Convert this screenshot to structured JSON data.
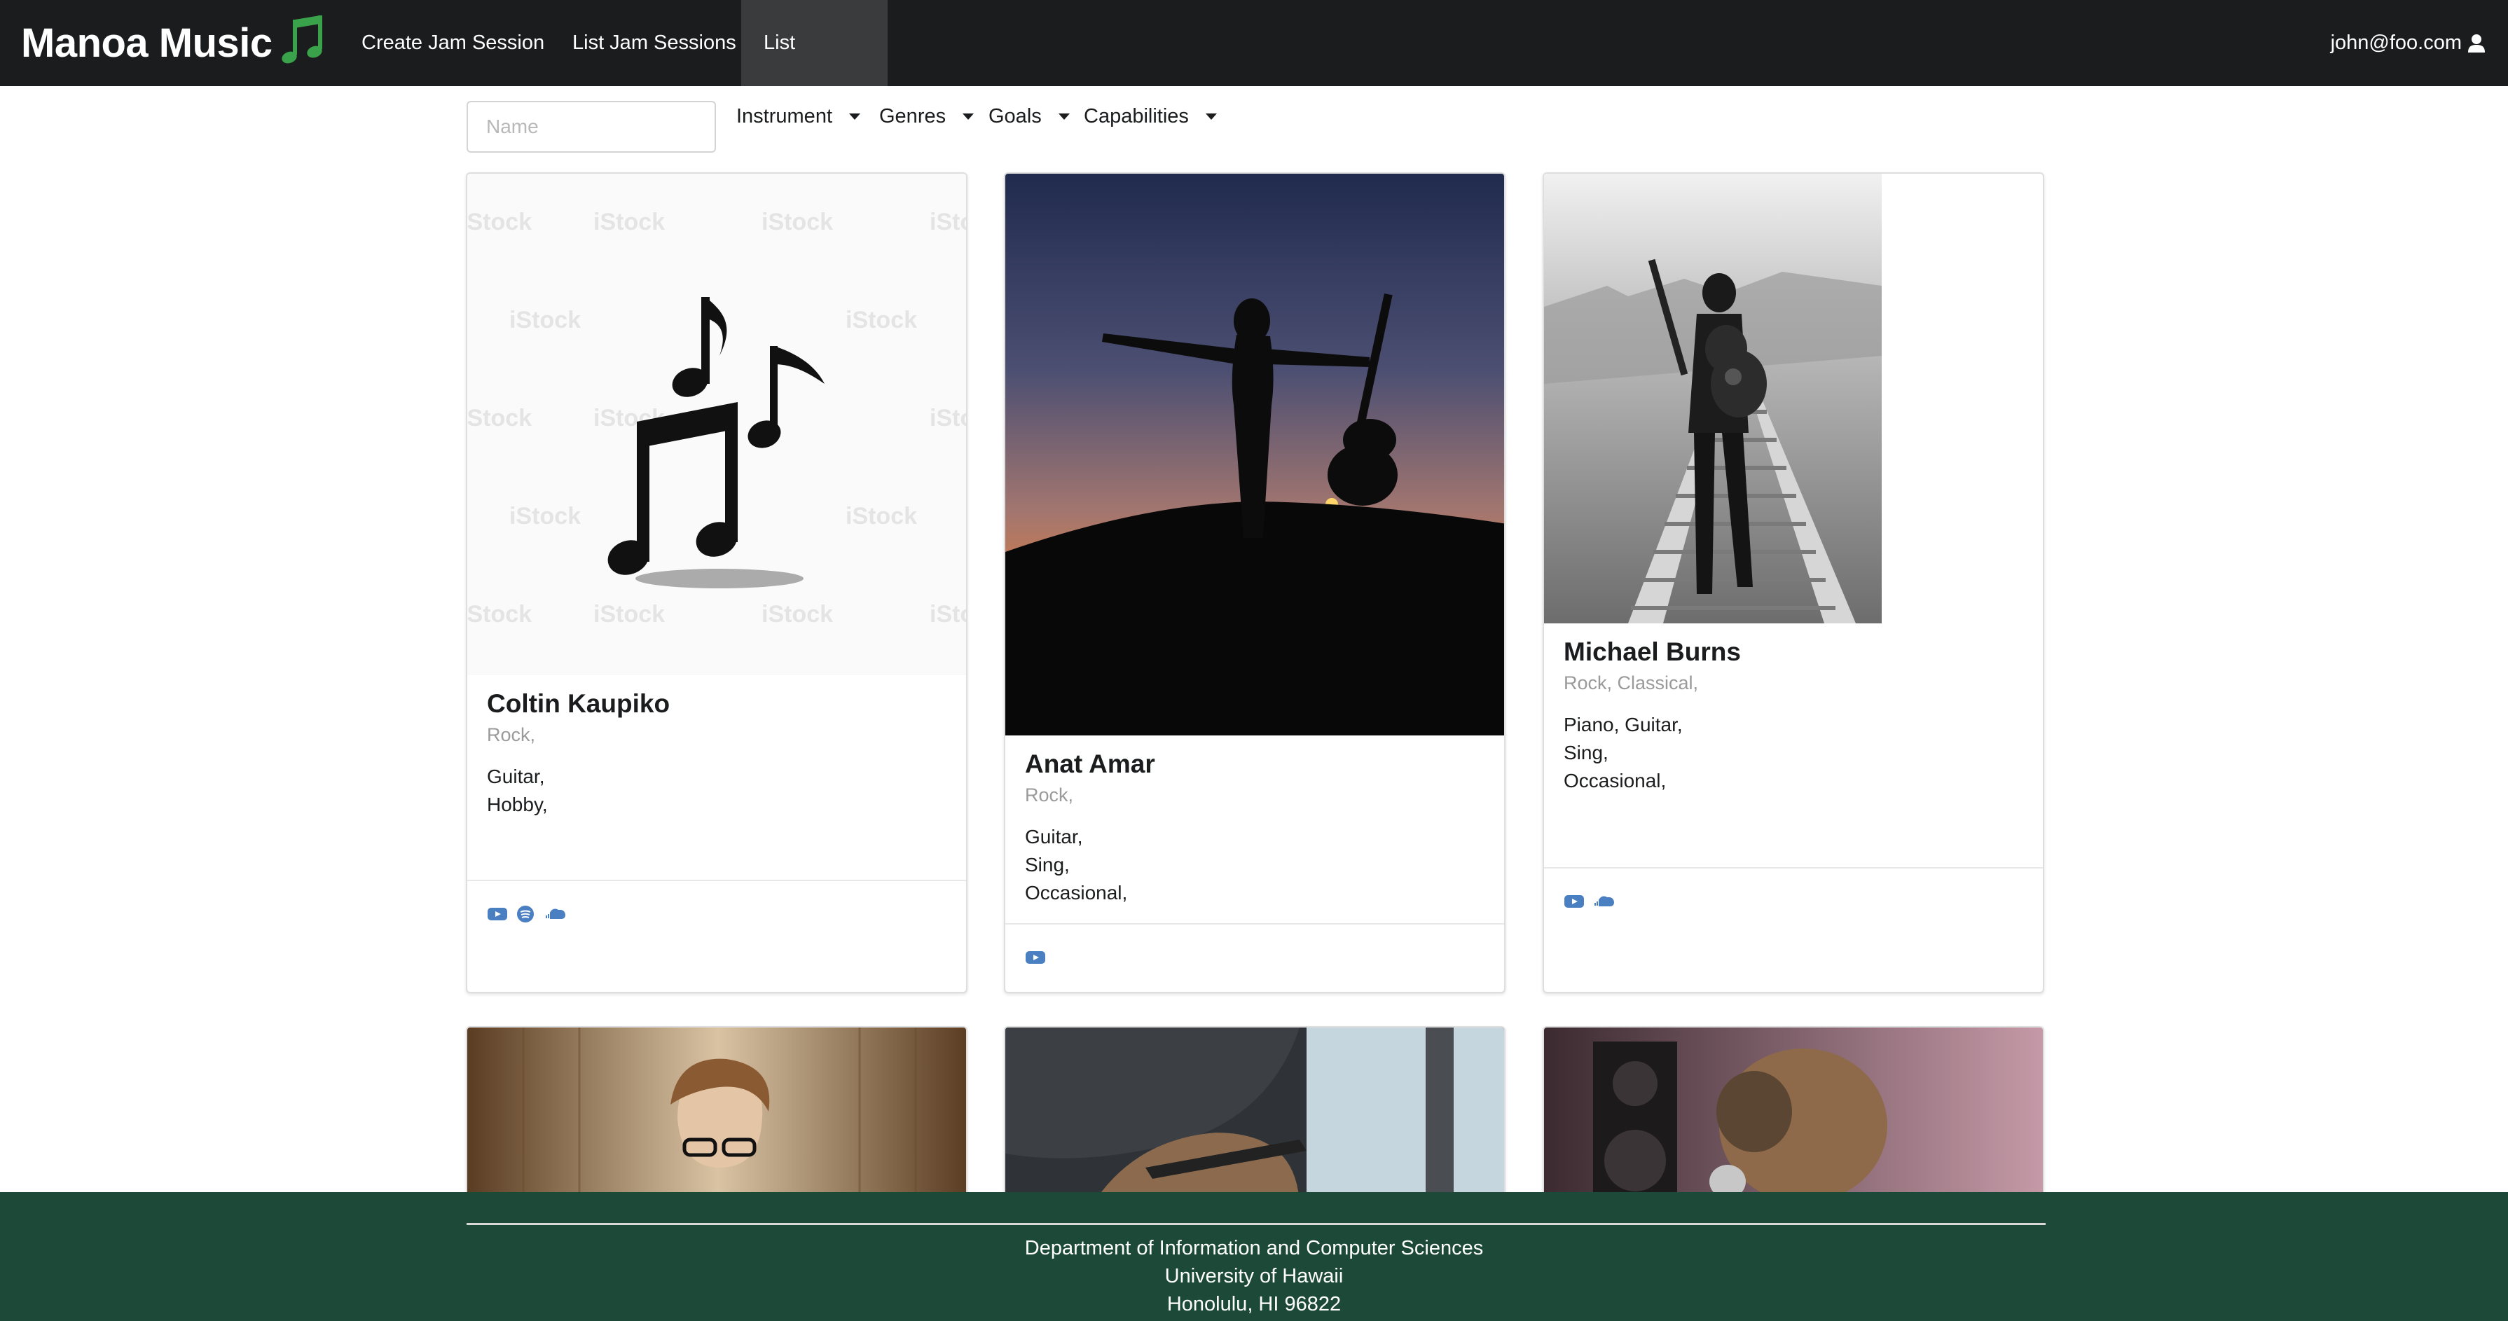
{
  "nav": {
    "brand": "Manoa Music",
    "items": [
      {
        "label": "Create Jam Session"
      },
      {
        "label": "List Jam Sessions"
      },
      {
        "label": "List Profiles",
        "active": true
      }
    ],
    "user": "john@foo.com",
    "user_icon": "user-icon",
    "brand_icon": "music-note-icon"
  },
  "filters": {
    "name_placeholder": "Name",
    "name_value": "",
    "instrument": "Instrument",
    "genres": "Genres",
    "goals": "Goals",
    "capabilities": "Capabilities"
  },
  "profiles": [
    {
      "name": "Coltin Kaupiko",
      "genres": "Rock,",
      "lines": [
        "Guitar,",
        "Hobby,"
      ],
      "links": [
        "youtube-icon",
        "spotify-icon",
        "soundcloud-icon"
      ]
    },
    {
      "name": "Anat Amar",
      "genres": "Rock,",
      "lines": [
        "Guitar,",
        "Sing,",
        "Occasional,"
      ],
      "links": [
        "youtube-icon"
      ]
    },
    {
      "name": "Michael Burns",
      "genres": "Rock, Classical,",
      "lines": [
        "Piano, Guitar,",
        "Sing,",
        "Occasional,"
      ],
      "links": [
        "youtube-icon",
        "soundcloud-icon"
      ]
    }
  ],
  "colors": {
    "navbar": "#1b1c1d",
    "footer": "#1d4a38",
    "link_icon": "#4a7fc1",
    "brand_note": "#3aa24a"
  },
  "footer": {
    "line1": "Department of Information and Computer Sciences",
    "line2": "University of Hawaii",
    "line3": "Honolulu, HI 96822"
  }
}
